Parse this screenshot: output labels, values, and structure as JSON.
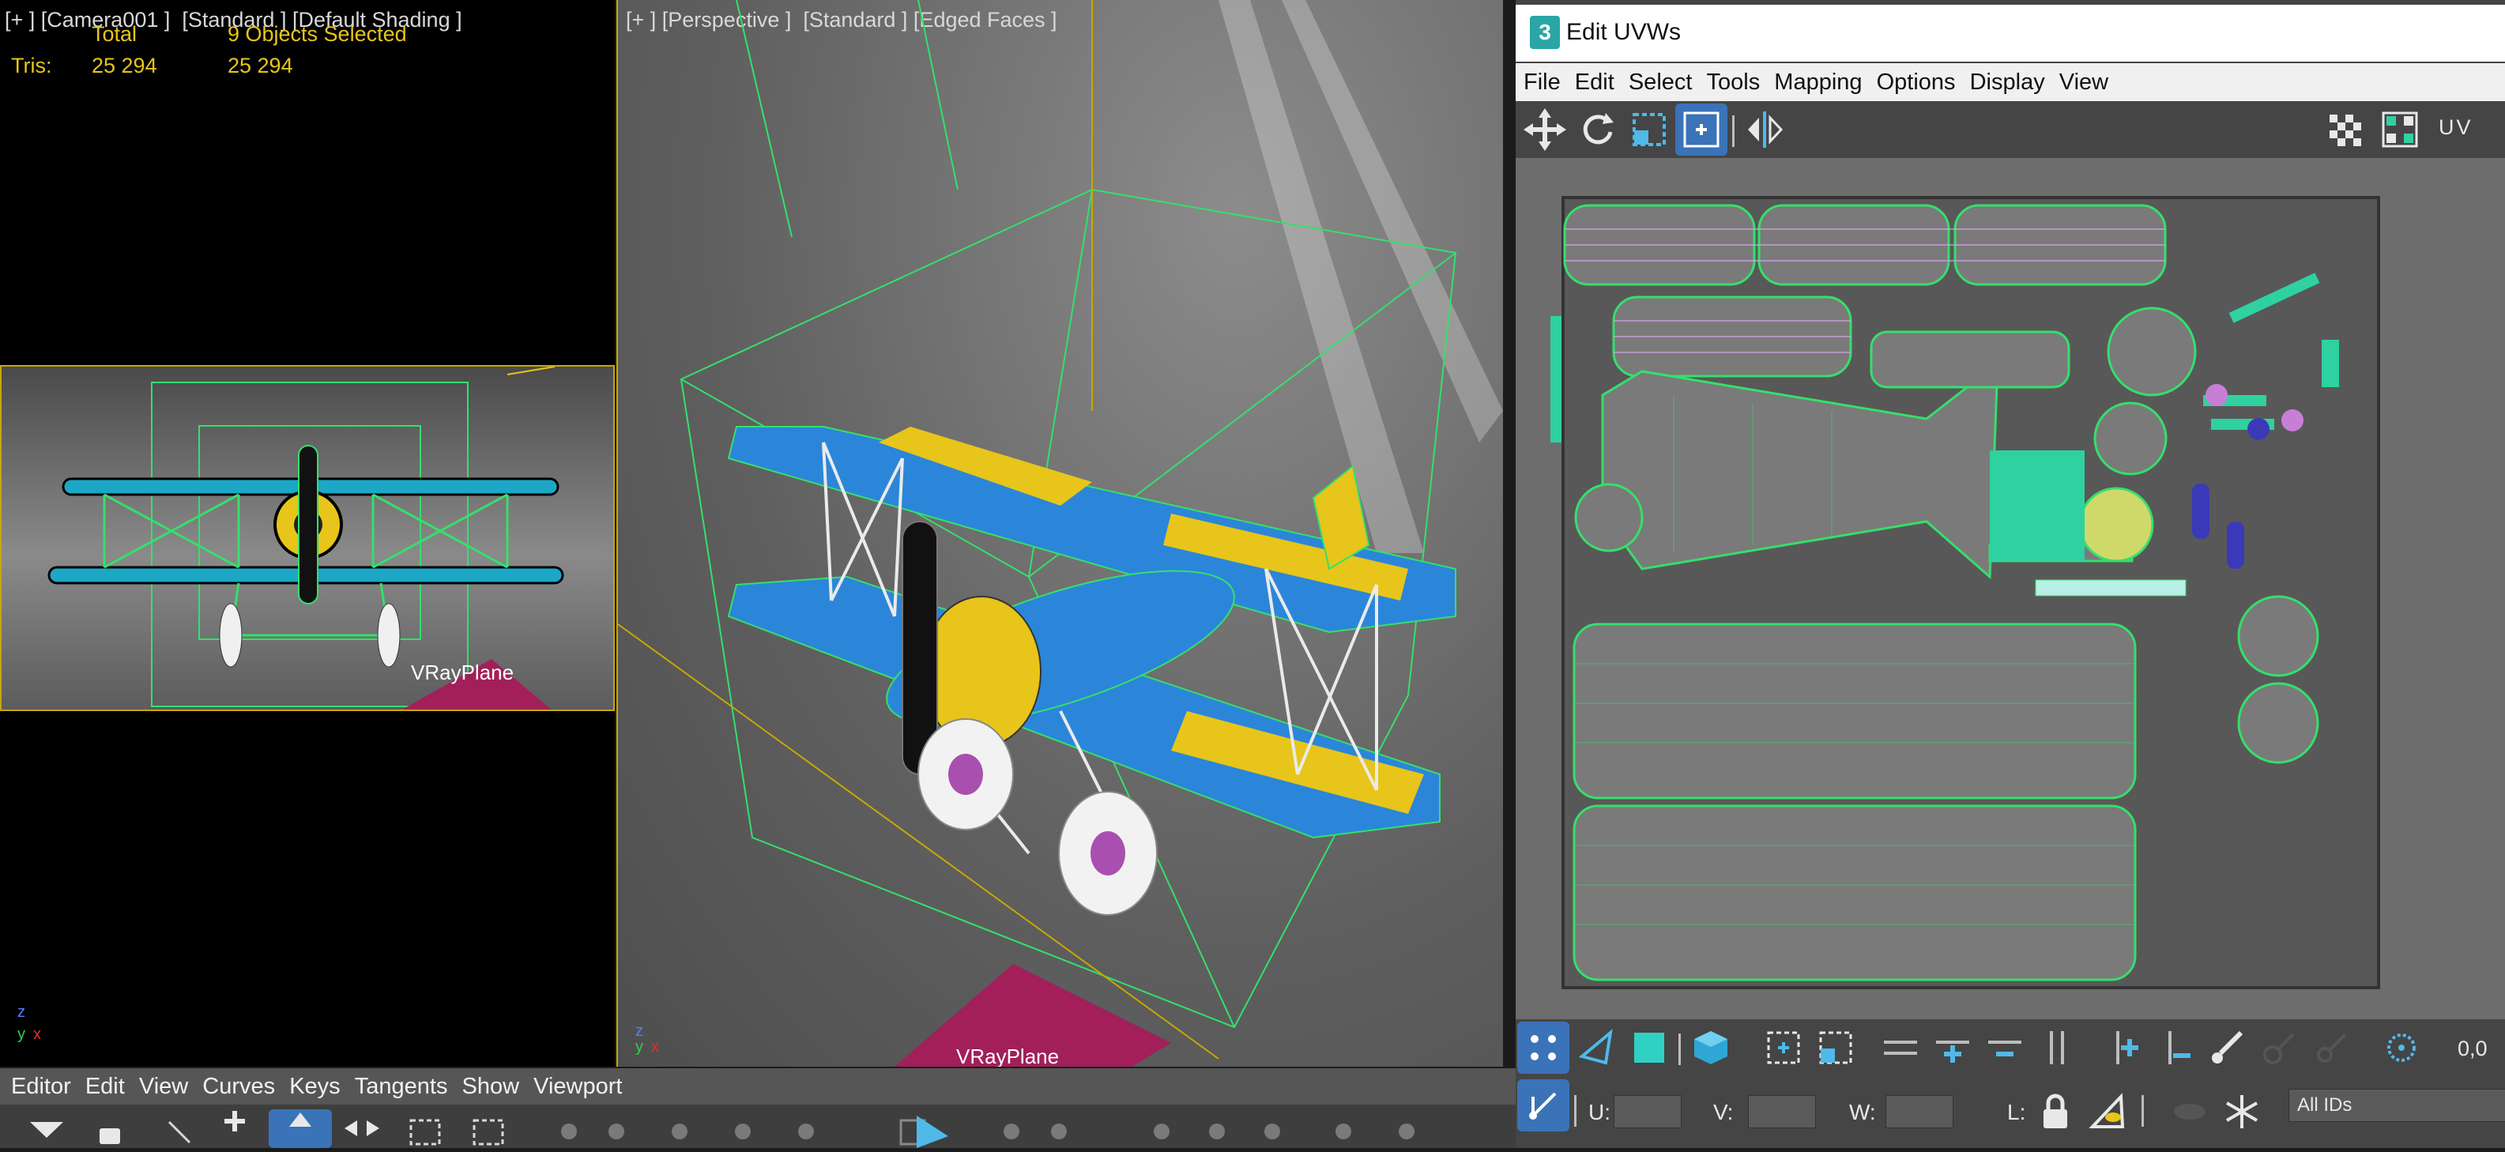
{
  "camera_viewport": {
    "label": "[+ ] [Camera001 ]  [Standard ] [Default Shading ]",
    "stats": {
      "total_label": "Total",
      "selected_label": "9 Objects Selected",
      "tris_label": "Tris:",
      "tris_total": "25 294",
      "tris_selected": "25 294"
    },
    "plane_label": "VRayPlane"
  },
  "perspective_viewport": {
    "label": "[+ ] [Perspective ]  [Standard ] [Edged Faces ]",
    "plane_label": "VRayPlane"
  },
  "axis_labels": {
    "z": "z",
    "y": "y",
    "x": "x"
  },
  "curve_editor": {
    "menu": [
      "Editor",
      "Edit",
      "View",
      "Curves",
      "Keys",
      "Tangents",
      "Show",
      "Viewport"
    ]
  },
  "edit_uvws": {
    "app_icon_text": "3",
    "title": "Edit UVWs",
    "menu": [
      "File",
      "Edit",
      "Select",
      "Tools",
      "Mapping",
      "Options",
      "Display",
      "View"
    ],
    "uv_toggle_label": "UV",
    "coord_readout": "0,0",
    "fields": {
      "u_label": "U:",
      "v_label": "V:",
      "w_label": "W:",
      "l_label": "L:"
    },
    "ids_label": "All IDs"
  },
  "colors": {
    "viewport_bg": "#000000",
    "perspective_bg": "#6a6a6a",
    "uv_bg": "#6f6f6f",
    "wire_green": "#34e06b",
    "stat_yellow": "#e7c51a",
    "selection_blue": "#2b7fd6",
    "vray_plane": "#a21f5a"
  }
}
